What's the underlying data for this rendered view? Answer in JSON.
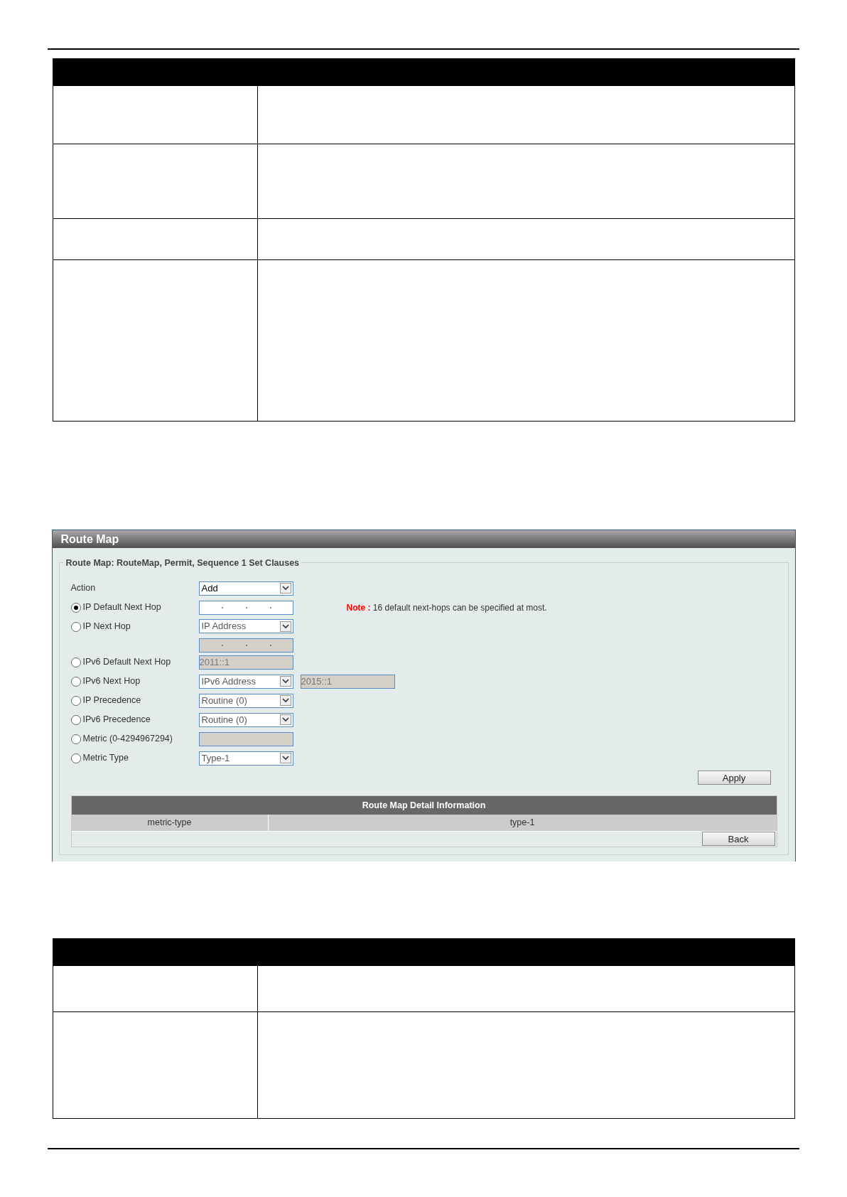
{
  "screenshot": {
    "title": "Route Map",
    "legend": "Route Map: RouteMap, Permit, Sequence 1 Set Clauses",
    "action": {
      "label": "Action",
      "value": "Add"
    },
    "options": [
      {
        "label": "IP Default Next Hop",
        "selected": true,
        "stacked": false,
        "fields": [
          {
            "kind": "ip",
            "disabled": false
          }
        ],
        "note": {
          "label": "Note :",
          "text": "16 default next-hops can be specified at most."
        }
      },
      {
        "label": "IP Next Hop",
        "selected": false,
        "stacked": true,
        "fields": [
          {
            "kind": "select",
            "value": "IP Address",
            "disabled": true
          },
          {
            "kind": "ip",
            "disabled": true
          }
        ]
      },
      {
        "label": "IPv6 Default Next Hop",
        "selected": false,
        "stacked": false,
        "fields": [
          {
            "kind": "text",
            "value": "2011::1",
            "disabled": true
          }
        ]
      },
      {
        "label": "IPv6 Next Hop",
        "selected": false,
        "stacked": false,
        "fields": [
          {
            "kind": "select",
            "value": "IPv6 Address",
            "disabled": true
          },
          {
            "kind": "text",
            "value": "2015::1",
            "disabled": true
          }
        ]
      },
      {
        "label": "IP Precedence",
        "selected": false,
        "stacked": false,
        "fields": [
          {
            "kind": "select",
            "value": "Routine (0)",
            "disabled": true
          }
        ]
      },
      {
        "label": "IPv6 Precedence",
        "selected": false,
        "stacked": false,
        "fields": [
          {
            "kind": "select",
            "value": "Routine (0)",
            "disabled": true
          }
        ]
      },
      {
        "label": "Metric (0-4294967294)",
        "selected": false,
        "stacked": false,
        "fields": [
          {
            "kind": "text",
            "disabled": true
          }
        ]
      },
      {
        "label": "Metric Type",
        "selected": false,
        "stacked": false,
        "fields": [
          {
            "kind": "select",
            "value": "Type-1",
            "disabled": true
          }
        ]
      }
    ],
    "apply_button": "Apply",
    "detail_table": {
      "title": "Route Map Detail Information",
      "rows": [
        {
          "cells": [
            "metric-type",
            "type-1"
          ]
        }
      ]
    },
    "back_button": "Back"
  }
}
